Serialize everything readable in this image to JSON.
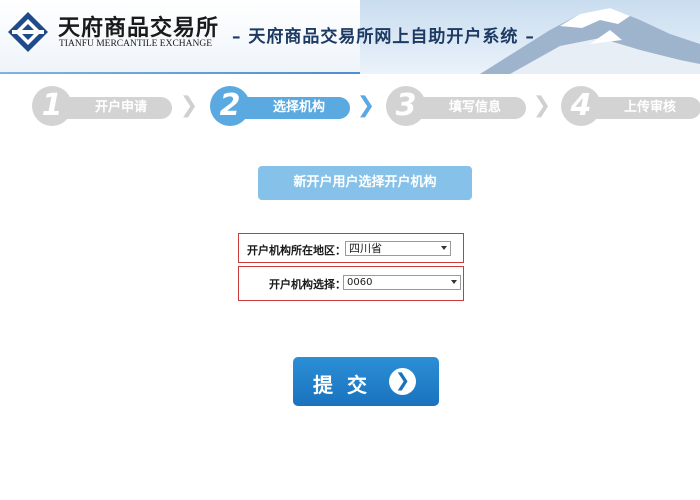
{
  "header": {
    "logo_cn": "天府商品交易所",
    "logo_en": "TIANFU MERCANTILE EXCHANGE",
    "title": "– 天府商品交易所网上自助开户系统 –"
  },
  "steps": [
    {
      "number": "1",
      "label": "开户申请",
      "active": false
    },
    {
      "number": "2",
      "label": "选择机构",
      "active": true
    },
    {
      "number": "3",
      "label": "填写信息",
      "active": false
    },
    {
      "number": "4",
      "label": "上传审核",
      "active": false
    }
  ],
  "section_title": "新开户用户选择开户机构",
  "form": {
    "region_label": "开户机构所在地区：",
    "region_value": "四川省",
    "institution_label": "开户机构选择：",
    "institution_value": "0060"
  },
  "submit": {
    "label": "提交"
  },
  "colors": {
    "accent": "#5aa9e0",
    "inactive_step": "#d3d3d3",
    "section_title_bg": "#86c1ea",
    "submit_bg": "#1f7fc8",
    "highlight_border": "#cc3b3b",
    "header_title": "#1d3a63"
  },
  "icons": {
    "logo": "logo-mark-icon",
    "step_arrow": "chevron-right-icon",
    "dropdown": "dropdown-arrow-icon",
    "submit": "arrow-right-circle-icon"
  }
}
